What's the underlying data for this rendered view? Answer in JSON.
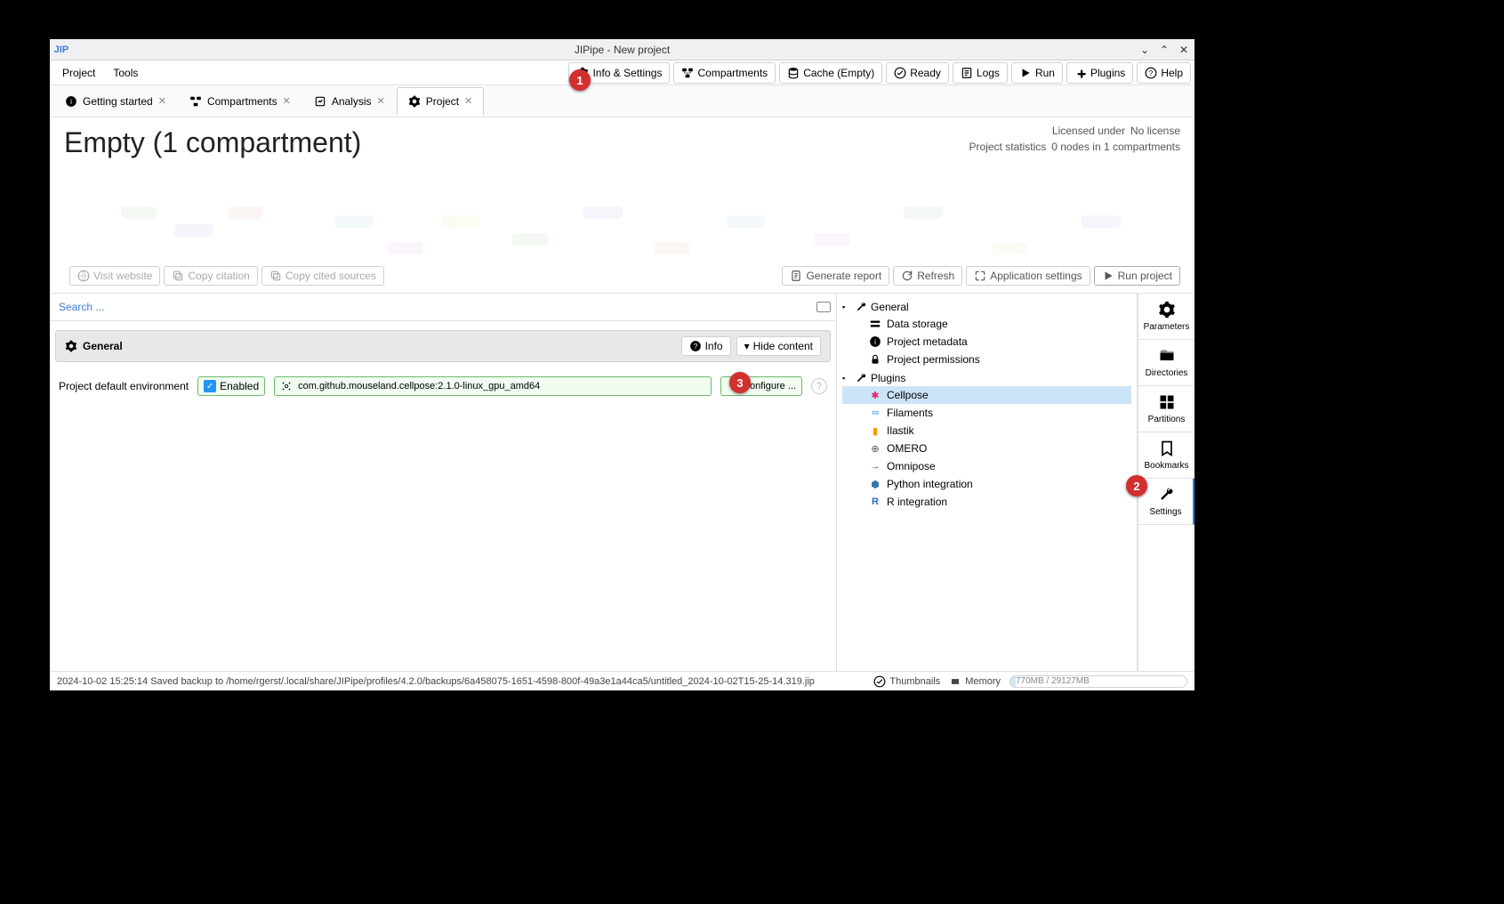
{
  "titlebar": {
    "title": "JIPipe - New project",
    "app_icon": "JIP"
  },
  "menubar": {
    "project": "Project",
    "tools": "Tools"
  },
  "toolbar": {
    "info_settings": "Info & Settings",
    "compartments": "Compartments",
    "cache": "Cache (Empty)",
    "ready": "Ready",
    "logs": "Logs",
    "run": "Run",
    "plugins": "Plugins",
    "help": "Help"
  },
  "tabs": [
    {
      "label": "Getting started",
      "icon": "info"
    },
    {
      "label": "Compartments",
      "icon": "compartments"
    },
    {
      "label": "Analysis",
      "icon": "analysis"
    },
    {
      "label": "Project",
      "icon": "gear",
      "active": true
    }
  ],
  "header": {
    "title": "Empty (1 compartment)",
    "license_label": "Licensed under",
    "license_value": "No license",
    "stats_label": "Project statistics",
    "stats_value": "0 nodes in 1 compartments",
    "visit_website": "Visit website",
    "copy_citation": "Copy citation",
    "copy_cited": "Copy cited sources",
    "generate_report": "Generate report",
    "refresh": "Refresh",
    "app_settings": "Application settings",
    "run_project": "Run project"
  },
  "search": {
    "placeholder": "Search ..."
  },
  "section": {
    "title": "General",
    "info": "Info",
    "hide": "Hide content"
  },
  "field": {
    "label": "Project default environment",
    "enabled": "Enabled",
    "value": "com.github.mouseland.cellpose:2.1.0-linux_gpu_amd64",
    "configure": "Configure ..."
  },
  "tree": {
    "general": "General",
    "data_storage": "Data storage",
    "project_metadata": "Project metadata",
    "project_permissions": "Project permissions",
    "plugins": "Plugins",
    "cellpose": "Cellpose",
    "filaments": "Filaments",
    "ilastik": "Ilastik",
    "omero": "OMERO",
    "omnipose": "Omnipose",
    "python": "Python integration",
    "r": "R integration"
  },
  "right_tabs": {
    "parameters": "Parameters",
    "directories": "Directories",
    "partitions": "Partitions",
    "bookmarks": "Bookmarks",
    "settings": "Settings"
  },
  "statusbar": {
    "message": "2024-10-02 15:25:14 Saved backup to /home/rgerst/.local/share/JIPipe/profiles/4.2.0/backups/6a458075-1651-4598-800f-49a3e1a44ca5/untitled_2024-10-02T15-25-14.319.jip",
    "thumbnails": "Thumbnails",
    "memory_label": "Memory",
    "memory_value": "770MB / 29127MB"
  },
  "callouts": {
    "c1": "1",
    "c2": "2",
    "c3": "3"
  }
}
